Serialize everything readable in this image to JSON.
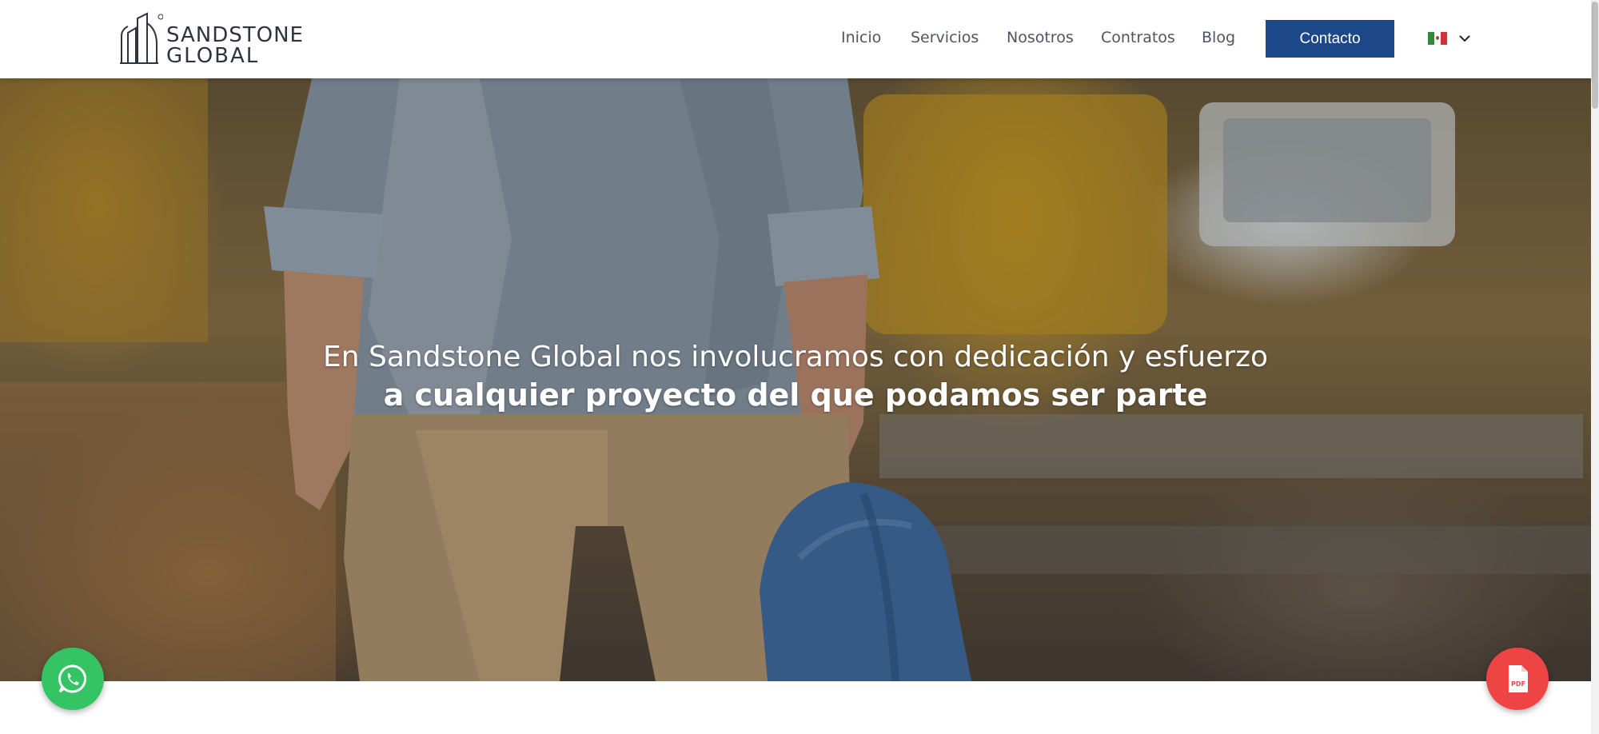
{
  "brand": {
    "name_line1": "SANDSTONE",
    "name_line2": "GLOBAL",
    "logo_icon": "building-outline-logo"
  },
  "nav": {
    "items": [
      {
        "label": "Inicio"
      },
      {
        "label": "Servicios"
      },
      {
        "label": "Nosotros"
      },
      {
        "label": "Contratos"
      },
      {
        "label": "Blog"
      }
    ],
    "contact_label": "Contacto",
    "language_icon": "mexico-flag-icon",
    "language_chevron": "chevron-down-icon"
  },
  "hero": {
    "line1": "En Sandstone Global nos involucramos con dedicación y esfuerzo",
    "line2": "a cualquier proyecto del que podamos ser parte"
  },
  "floating": {
    "whatsapp_icon": "whatsapp-icon",
    "pdf_icon": "pdf-file-icon"
  },
  "colors": {
    "primary": "#1c4889",
    "nav_text": "#4d5563",
    "whatsapp": "#34c463",
    "pdf": "#ef4444"
  }
}
